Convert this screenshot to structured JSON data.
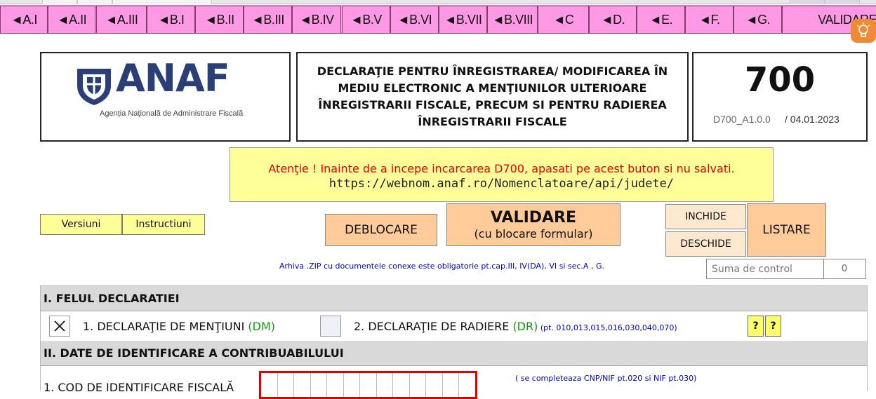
{
  "nav": {
    "items": [
      "◄A.I",
      "◄A.II",
      "◄A.III",
      "◄B.I",
      "◄B.II",
      "◄B.III",
      "◄B.IV",
      "◄B.V",
      "◄B.VI",
      "◄B.VII",
      "◄B.VIII",
      "◄C",
      "◄D.",
      "◄E.",
      "◄F.",
      "◄G.",
      "VALIDARE"
    ]
  },
  "header": {
    "logo_text": "ANAF",
    "logo_subtitle": "Agenția Națională de Administrare Fiscală",
    "title": "DECLARAŢIE PENTRU ÎNREGISTRAREA/ MODIFICAREA ÎN MEDIU ELECTRONIC A MENŢIUNILOR ULTERIOARE ÎNREGISTRARII FISCALE, PRECUM SI PENTRU RADIEREA ÎNREGISTRARII FISCALE",
    "form_number": "700",
    "version": "D700_A1.0.0",
    "date": "/ 04.01.2023"
  },
  "notice": {
    "line1": "Atenţie ! Inainte de a incepe incarcarea D700, apasati pe acest buton si nu salvati.",
    "line2": "https://webnom.anaf.ro/Nomenclatoare/api/judete/"
  },
  "buttons": {
    "versiuni": "Versiuni",
    "instructiuni": "Instructiuni",
    "deblocare": "DEBLOCARE",
    "validare": "VALIDARE",
    "validare_sub": "(cu blocare formular)",
    "inchide": "INCHIDE",
    "deschide": "DESCHIDE",
    "listare": "LISTARE"
  },
  "arhiva_note": "Arhiva .ZIP cu documentele conexe este obligatorie pt.cap.III, IV(DA), VI si sec.A , G.",
  "suma": {
    "label": "Suma de control",
    "value": "0"
  },
  "section1": {
    "title": "I.  FELUL DECLARATIEI",
    "option1_checked": true,
    "option1_label": "1. DECLARAŢIE DE MENŢIUNI ",
    "option1_code": "(DM)",
    "option2_checked": false,
    "option2_label": "2. DECLARAŢIE DE RADIERE ",
    "option2_code": "(DR)",
    "option2_note": " (pt. 010,013,015,016,030,040,070)",
    "help1": "?",
    "help2": "?"
  },
  "section2": {
    "title": "II. DATE DE IDENTIFICARE  A CONTRIBUABILULUI",
    "cif_label": "1. COD DE IDENTIFICARE FISCALĂ",
    "cif_note": "( se completeaza CNP/NIF pt.020 si NIF pt.030)"
  },
  "colors": {
    "nav_bg": "#ff99e5",
    "notice_bg": "#ffff99",
    "notice_text": "#e30000",
    "orange_button": "#ffcc99",
    "logo_blue": "#2a3f77",
    "cif_border": "#e00000",
    "green_code": "#129a12"
  },
  "icons": {
    "bulb": "lightbulb-icon",
    "shield": "anaf-shield-icon",
    "checkmark": "x-mark-icon"
  }
}
